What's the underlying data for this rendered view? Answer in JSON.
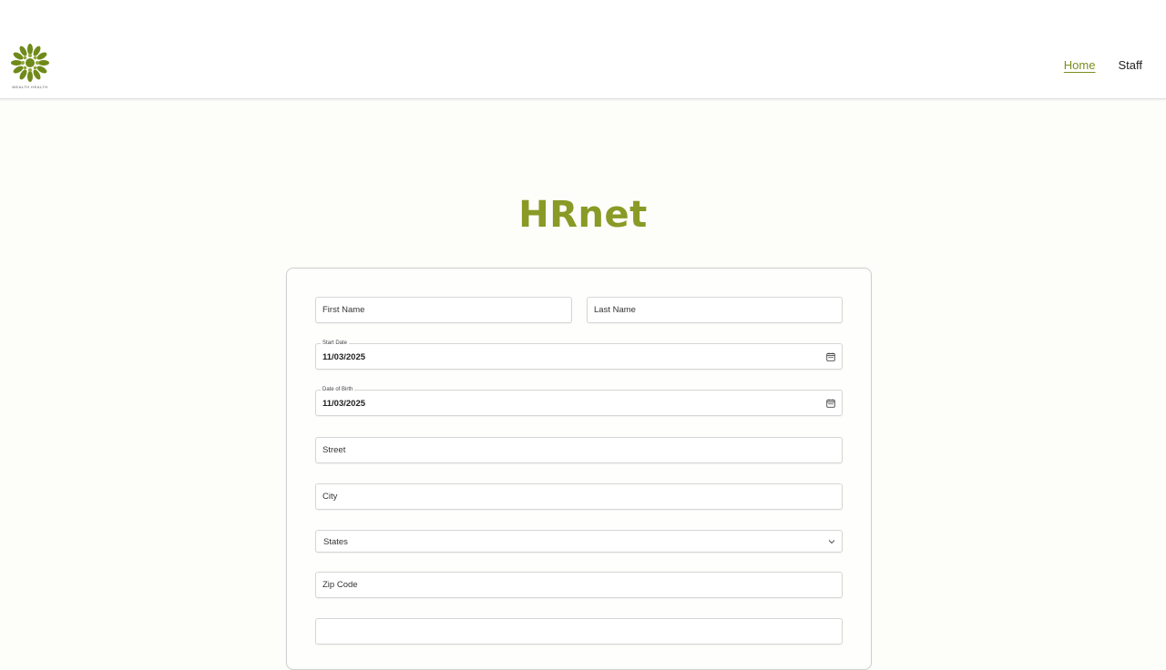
{
  "header": {
    "logo_text": "WEALTH HEALTH",
    "nav": [
      {
        "label": "Home",
        "active": true
      },
      {
        "label": "Staff",
        "active": false
      }
    ]
  },
  "page": {
    "title": "HRnet"
  },
  "form": {
    "first_name": {
      "placeholder": "First Name",
      "value": ""
    },
    "last_name": {
      "placeholder": "Last Name",
      "value": ""
    },
    "start_date": {
      "label": "Start Date",
      "value": "11/03/2025"
    },
    "date_of_birth": {
      "label": "Date of Birth",
      "value": "11/03/2025"
    },
    "street": {
      "placeholder": "Street",
      "value": ""
    },
    "city": {
      "placeholder": "City",
      "value": ""
    },
    "state": {
      "selected": "States"
    },
    "zip_code": {
      "placeholder": "Zip Code",
      "value": ""
    }
  },
  "colors": {
    "brand_green": "#8a9a26",
    "nav_active": "#7d8c1e"
  },
  "icons": {
    "logo": "sunburst-logo",
    "calendar": "calendar-icon",
    "select_arrow": "chevron-down-icon"
  }
}
